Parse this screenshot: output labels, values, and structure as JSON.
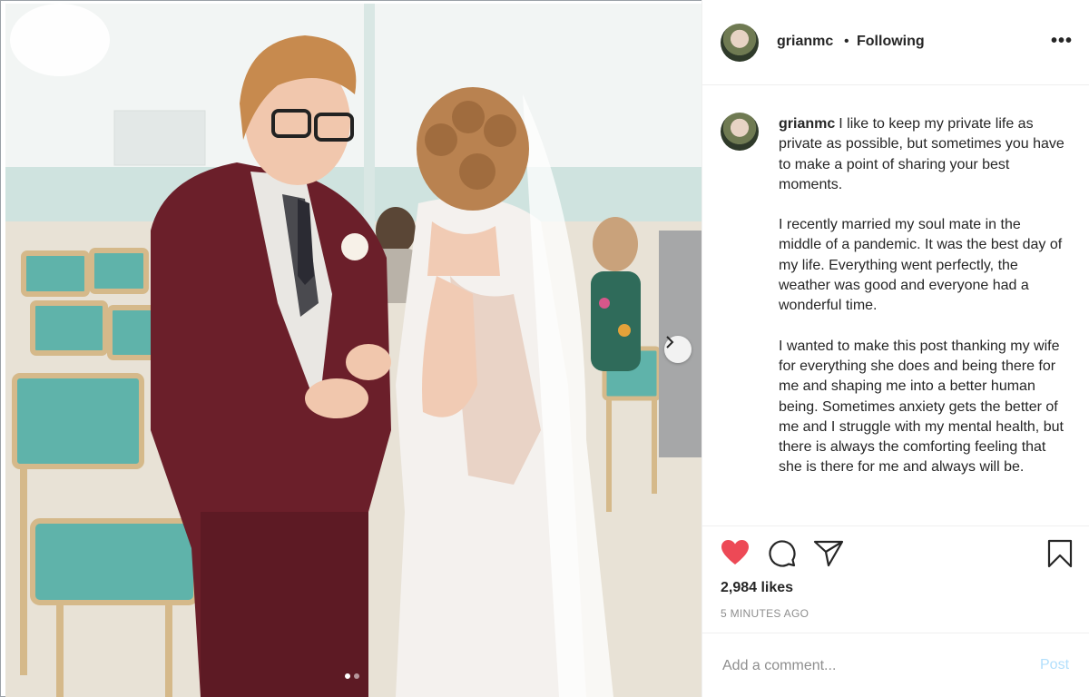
{
  "post": {
    "username": "grianmc",
    "separator": "•",
    "follow_label": "Following",
    "more_label": "•••"
  },
  "caption": {
    "username": "grianmc",
    "paragraph_1": "I like to keep my private life as private as possible, but sometimes you have to make a point of sharing your best moments.",
    "paragraph_2": "I recently married my soul mate in the middle of a pandemic. It was the best day of my life. Everything went perfectly, the weather was good and everyone had a wonderful time.",
    "paragraph_3": "I wanted to make this post thanking my wife for everything she does and being there for me and shaping me into a better human being. Sometimes anxiety gets the better of me and I struggle with my mental health, but there is always the comforting feeling that she is there for me and always will be."
  },
  "stats": {
    "likes": "2,984 likes",
    "time": "5 MINUTES AGO"
  },
  "comment": {
    "placeholder": "Add a comment...",
    "post_label": "Post"
  },
  "carousel": {
    "slide_count": 2,
    "active_slide": 1
  },
  "icons": {
    "like": "heart-icon",
    "comment": "comment-icon",
    "share": "share-icon",
    "save": "bookmark-icon",
    "next": "chevron-right-icon"
  },
  "colors": {
    "like_red": "#ed4956",
    "post_disabled": "#b2dffc",
    "muted_text": "#8e8e8e",
    "suit": "#6b1f2a"
  }
}
